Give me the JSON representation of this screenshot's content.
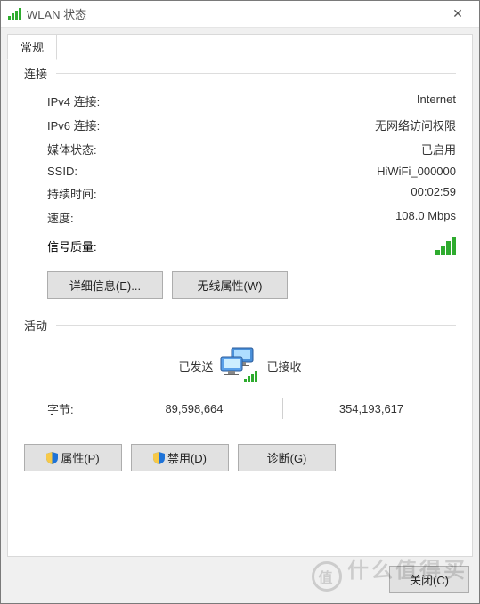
{
  "window": {
    "title": "WLAN 状态",
    "close": "✕"
  },
  "tab": {
    "general": "常规"
  },
  "section": {
    "connection": "连接",
    "activity": "活动"
  },
  "conn": {
    "ipv4_k": "IPv4 连接:",
    "ipv4_v": "Internet",
    "ipv6_k": "IPv6 连接:",
    "ipv6_v": "无网络访问权限",
    "media_k": "媒体状态:",
    "media_v": "已启用",
    "ssid_k": "SSID:",
    "ssid_v": "HiWiFi_000000",
    "dur_k": "持续时间:",
    "dur_v": "00:02:59",
    "speed_k": "速度:",
    "speed_v": "108.0 Mbps",
    "signal_k": "信号质量:"
  },
  "buttons": {
    "details": "详细信息(E)...",
    "wireless_props": "无线属性(W)",
    "properties": "属性(P)",
    "disable": "禁用(D)",
    "diagnose": "诊断(G)",
    "close": "关闭(C)"
  },
  "activity": {
    "sent": "已发送",
    "received": "已接收",
    "bytes_label": "字节:",
    "sent_bytes": "89,598,664",
    "recv_bytes": "354,193,617"
  },
  "watermark": {
    "logo": "值",
    "text": "什么值得买"
  }
}
